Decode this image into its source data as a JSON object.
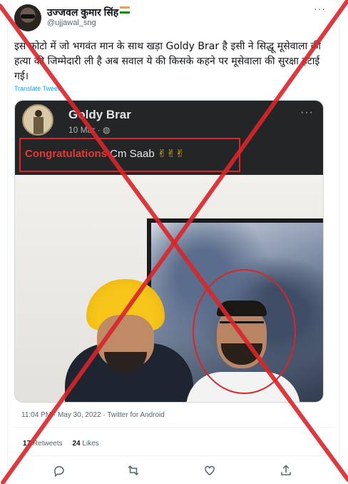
{
  "tweet": {
    "display_name": "उज्जवल कुमार सिंह",
    "handle": "@ujjawal_sng",
    "more_icon": "more-icon",
    "text": "इस फोटो में जो भगवंत मान के साथ खड़ा Goldy Brar है इसी ने सिद्धू मूसेवाला की हत्या की जिम्मेदारी ली है अब सवाल ये की किसके कहने पर मूसेवाला  की सुरक्षा हटाई गई।",
    "translate_label": "Translate Tweet",
    "timestamp": "11:04 PM · May 30, 2022 · Twitter for Android",
    "retweets_count": "17",
    "retweets_label": "Retweets",
    "likes_count": "24",
    "likes_label": "Likes"
  },
  "embedded_post": {
    "name": "Goldy Brar",
    "date": "10 Mar · ",
    "highlight_text": "Congratulations",
    "rest_text": " Cm Saab ",
    "emoji": "✌✌✌"
  },
  "actions": [
    "reply-icon",
    "retweet-icon",
    "like-icon",
    "share-icon"
  ],
  "colors": {
    "overlay_cross": "#d9252a",
    "link": "#1d9bf0",
    "secondary_text": "#536471"
  }
}
